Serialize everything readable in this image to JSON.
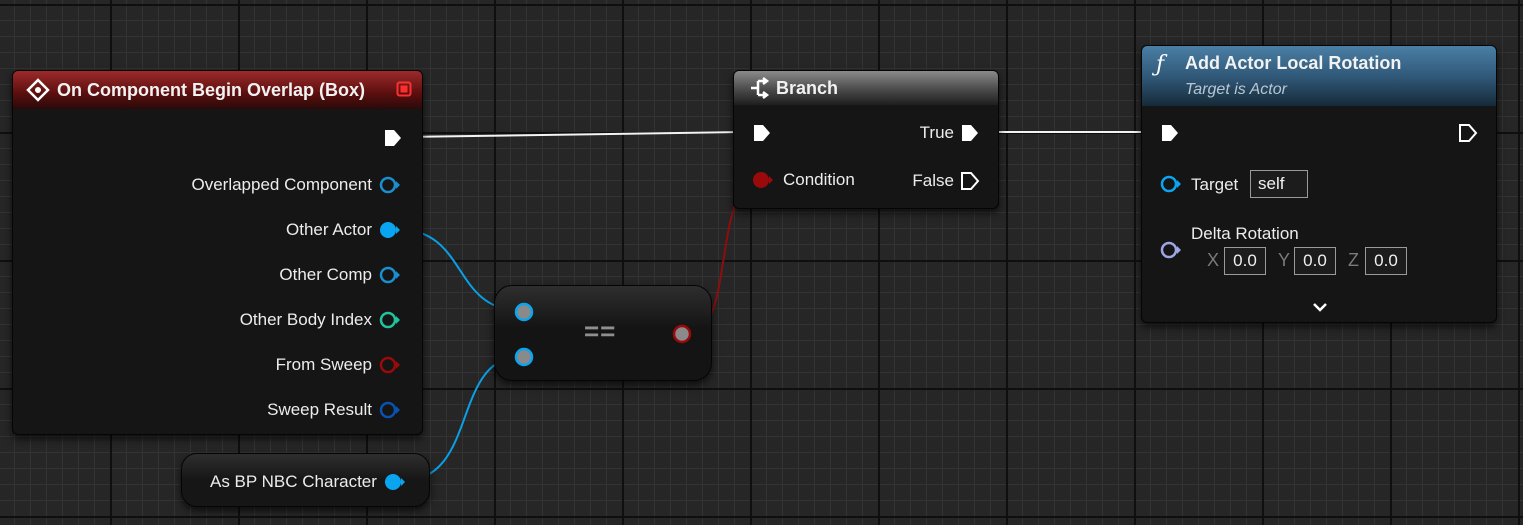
{
  "event_node": {
    "title": "On Component Begin Overlap (Box)",
    "pins": {
      "overlapped_component": "Overlapped Component",
      "other_actor": "Other Actor",
      "other_comp": "Other Comp",
      "other_body_index": "Other Body Index",
      "from_sweep": "From Sweep",
      "sweep_result": "Sweep Result"
    }
  },
  "branch_node": {
    "title": "Branch",
    "condition": "Condition",
    "true": "True",
    "false": "False"
  },
  "rotation_node": {
    "icon": "ƒ",
    "title": "Add Actor Local Rotation",
    "subtitle": "Target is Actor",
    "target_label": "Target",
    "target_value": "self",
    "delta_label": "Delta Rotation",
    "x_label": "X",
    "x_value": "0.0",
    "y_label": "Y",
    "y_value": "0.0",
    "z_label": "Z",
    "z_value": "0.0",
    "expand_icon": "chevron-down-icon"
  },
  "equal_node": {
    "label": "=="
  },
  "cast_node": {
    "label": "As BP NBC Character"
  },
  "colors": {
    "exec": "#ffffff",
    "object_pin": "#0aa5f0",
    "component_pin": "#1a8ecf",
    "int_pin": "#20c4a0",
    "bool_pin": "#9b0a0a",
    "struct_pin": "#0a52b0",
    "rotator_pin": "#9ea6e6",
    "event_header": "#8b1a1a",
    "function_header": "#3f6d8e"
  }
}
